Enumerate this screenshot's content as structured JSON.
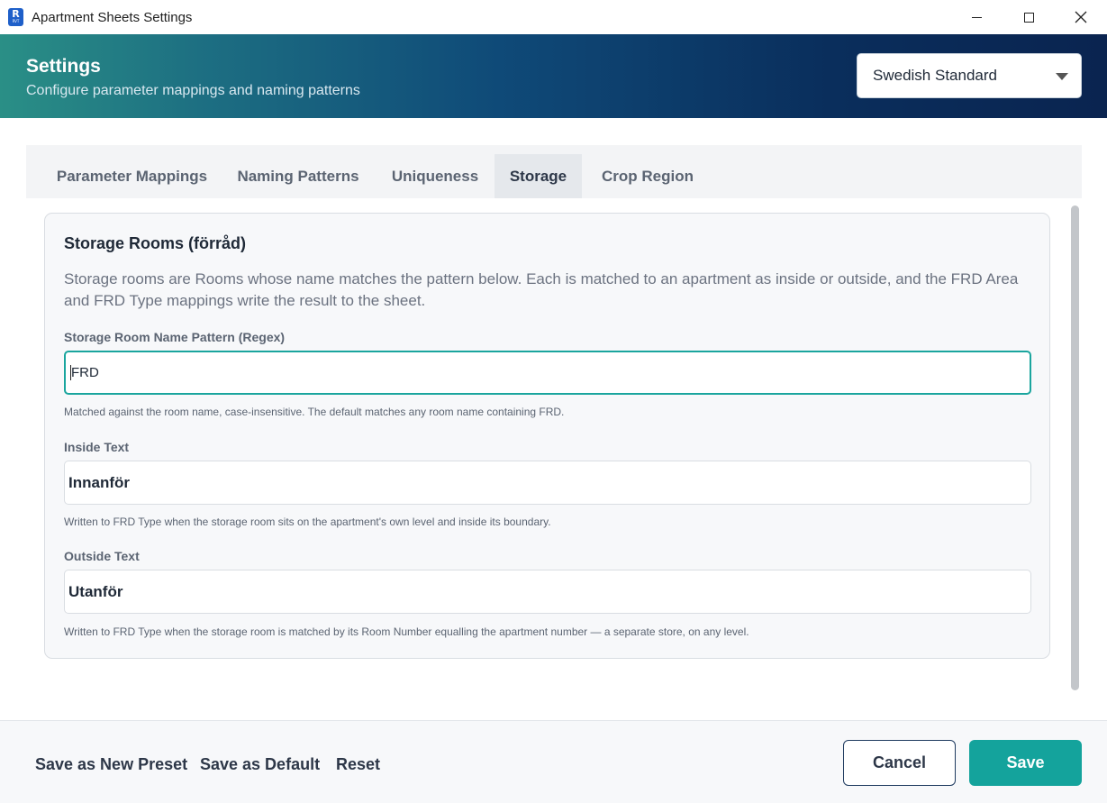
{
  "window": {
    "title": "Apartment Sheets Settings",
    "app_icon_letter": "R",
    "app_icon_sub": "RVT"
  },
  "header": {
    "title": "Settings",
    "subtitle": "Configure parameter mappings and naming patterns",
    "preset_selected": "Swedish Standard"
  },
  "tabs": [
    {
      "label": "Parameter Mappings",
      "active": false
    },
    {
      "label": "Naming Patterns",
      "active": false
    },
    {
      "label": "Uniqueness",
      "active": false
    },
    {
      "label": "Storage",
      "active": true
    },
    {
      "label": "Crop Region",
      "active": false
    }
  ],
  "storage": {
    "title": "Storage Rooms (förråd)",
    "description": "Storage rooms are Rooms whose name matches the pattern below. Each is matched to an apartment as inside or outside, and the FRD Area and FRD Type mappings write the result to the sheet.",
    "pattern_label": "Storage Room Name Pattern (Regex)",
    "pattern_value": "FRD",
    "pattern_hint": "Matched against the room name, case-insensitive. The default matches any room name containing FRD.",
    "inside_label": "Inside Text",
    "inside_value": "Innanför",
    "inside_hint": "Written to FRD Type when the storage room sits on the apartment's own level and inside its boundary.",
    "outside_label": "Outside Text",
    "outside_value": "Utanför",
    "outside_hint": "Written to FRD Type when the storage room is matched by its Room Number equalling the apartment number — a separate store, on any level."
  },
  "footer": {
    "save_new_preset": "Save as New Preset",
    "save_default": "Save as Default",
    "reset": "Reset",
    "cancel": "Cancel",
    "save": "Save"
  },
  "colors": {
    "accent": "#14a39c",
    "header_start": "#2a8f86",
    "header_end": "#0a2450"
  }
}
